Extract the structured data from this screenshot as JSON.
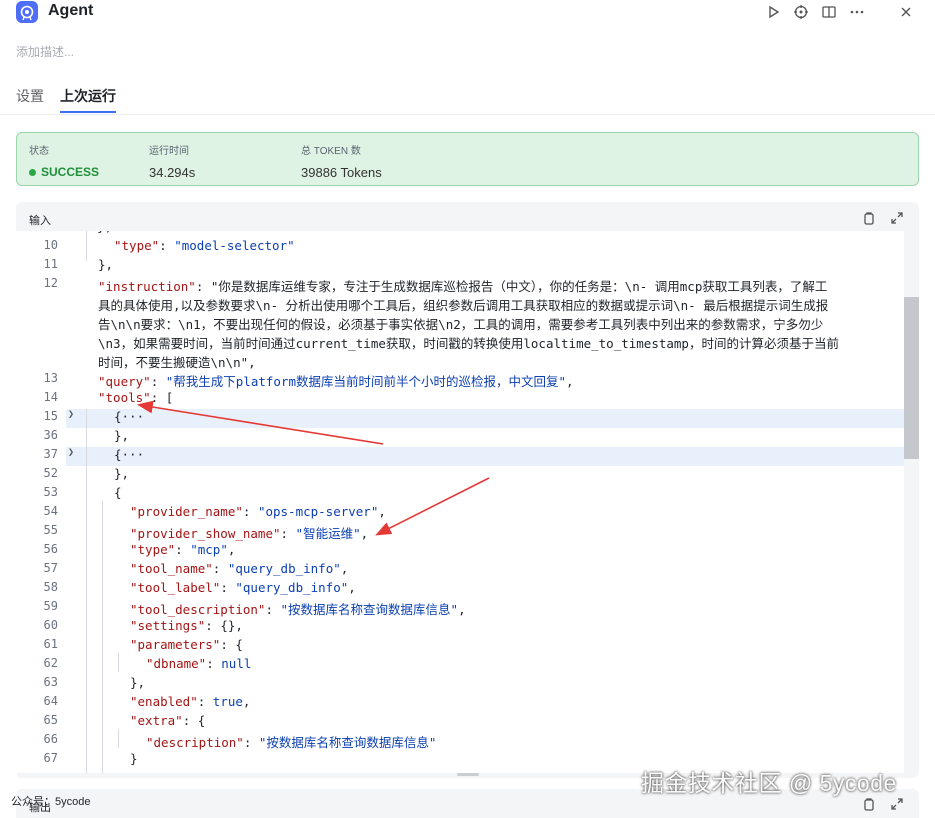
{
  "app": {
    "title": "Agent",
    "description_placeholder": "添加描述..."
  },
  "header_actions": {
    "run_icon": "play-icon",
    "debug_icon": "crosshair-icon",
    "layout_icon": "split-view-icon",
    "more_icon": "more-icon",
    "close_icon": "close-icon"
  },
  "tabs": [
    {
      "label": "设置",
      "active": false
    },
    {
      "label": "上次运行",
      "active": true
    }
  ],
  "status": {
    "status_label": "状态",
    "status_value": "SUCCESS",
    "runtime_label": "运行时间",
    "runtime_value": "34.294s",
    "tokens_label": "总 TOKEN 数",
    "tokens_value": "39886 Tokens",
    "success_color": "#29a746"
  },
  "input_panel": {
    "label": "输入",
    "copy_icon": "copy-icon",
    "expand_icon": "expand-icon"
  },
  "code_lines": [
    {
      "ln": "10",
      "text": "  \"type\": \"model-selector\""
    },
    {
      "ln": "11",
      "text": "},"
    },
    {
      "ln": "12",
      "text": "\"instruction\": \"你是数据库运维专家，专注于生成数据库巡检报告（中文），你的任务是：\\n- 调用mcp获取工具列表，了解工"
    },
    {
      "ln": "",
      "text": "具的具体使用,以及参数要求\\n- 分析出使用哪个工具后，组织参数后调用工具获取相应的数据或提示词\\n- 最后根据提示词生成报"
    },
    {
      "ln": "",
      "text": "告\\n\\n要求：\\n1，不要出现任何的假设，必须基于事实依据\\n2，工具的调用，需要参考工具列表中列出来的参数需求，宁多勿少"
    },
    {
      "ln": "",
      "text": "\\n3，如果需要时间，当前时间通过current_time获取，时间戳的转换使用localtime_to_timestamp，时间的计算必须基于当前"
    },
    {
      "ln": "",
      "text": "时间，不要生搬硬造\\n\\n\","
    },
    {
      "ln": "13",
      "text": "\"query\": \"帮我生成下platform数据库当前时间前半个小时的巡检报，中文回复\","
    },
    {
      "ln": "14",
      "text": "\"tools\": ["
    },
    {
      "ln": "15",
      "text": "  {···"
    },
    {
      "ln": "36",
      "text": "  },"
    },
    {
      "ln": "37",
      "text": "  {···"
    },
    {
      "ln": "52",
      "text": "  },"
    },
    {
      "ln": "53",
      "text": "  {"
    },
    {
      "ln": "54",
      "text": "    \"provider_name\": \"ops-mcp-server\","
    },
    {
      "ln": "55",
      "text": "    \"provider_show_name\": \"智能运维\","
    },
    {
      "ln": "56",
      "text": "    \"type\": \"mcp\","
    },
    {
      "ln": "57",
      "text": "    \"tool_name\": \"query_db_info\","
    },
    {
      "ln": "58",
      "text": "    \"tool_label\": \"query_db_info\","
    },
    {
      "ln": "59",
      "text": "    \"tool_description\": \"按数据库名称查询数据库信息\","
    },
    {
      "ln": "60",
      "text": "    \"settings\": {},"
    },
    {
      "ln": "61",
      "text": "    \"parameters\": {"
    },
    {
      "ln": "62",
      "text": "      \"dbname\": null"
    },
    {
      "ln": "63",
      "text": "    },"
    },
    {
      "ln": "64",
      "text": "    \"enabled\": true,"
    },
    {
      "ln": "65",
      "text": "    \"extra\": {"
    },
    {
      "ln": "66",
      "text": "      \"description\": \"按数据库名称查询数据库信息\""
    },
    {
      "ln": "67",
      "text": "    }"
    }
  ],
  "output_panel": {
    "label": "输出"
  },
  "footer": {
    "credit": "公众号：5ycode",
    "watermark": "掘金技术社区 @ 5ycode"
  }
}
